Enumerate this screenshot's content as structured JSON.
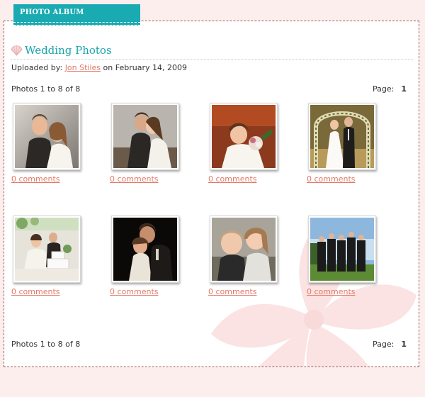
{
  "header": {
    "tab_label": "PHOTO ALBUM"
  },
  "album": {
    "title": "Wedding Photos",
    "uploaded_prefix": "Uploaded by:",
    "uploader": "Jon Stiles",
    "uploaded_suffix": "on February 14, 2009",
    "photos_count_label": "Photos 1 to 8 of 8",
    "page_label": "Page:",
    "page_number": "1"
  },
  "photos": [
    {
      "comments": "0 comments"
    },
    {
      "comments": "0 comments"
    },
    {
      "comments": "0 comments"
    },
    {
      "comments": "0 comments"
    },
    {
      "comments": "0 comments"
    },
    {
      "comments": "0 comments"
    },
    {
      "comments": "0 comments"
    },
    {
      "comments": "0 comments"
    }
  ],
  "colors": {
    "accent": "#19abb1",
    "link": "#e27966",
    "background": "#fdeeee"
  }
}
